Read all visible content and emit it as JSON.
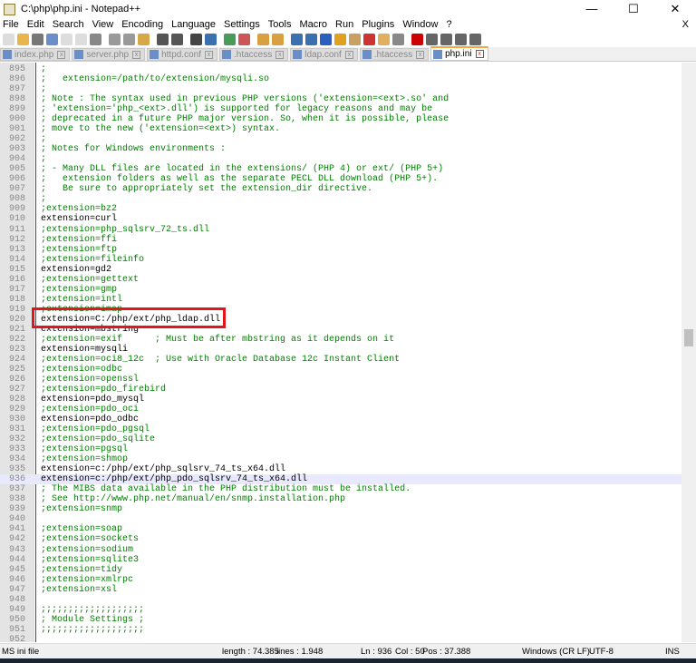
{
  "window": {
    "title": "C:\\php\\php.ini - Notepad++",
    "minimize": "—",
    "maximize": "☐",
    "close": "✕"
  },
  "menu": [
    "File",
    "Edit",
    "Search",
    "View",
    "Encoding",
    "Language",
    "Settings",
    "Tools",
    "Macro",
    "Run",
    "Plugins",
    "Window",
    "?"
  ],
  "menu_close": "X",
  "tabs": [
    {
      "label": "index.php"
    },
    {
      "label": "server.php"
    },
    {
      "label": "httpd.conf"
    },
    {
      "label": ".htaccess"
    },
    {
      "label": "ldap.conf"
    },
    {
      "label": ".htaccess"
    },
    {
      "label": "php.ini",
      "active": true
    }
  ],
  "editor": {
    "first_line": 895,
    "current_line": 936,
    "highlighted_line": 920,
    "lines": [
      ";",
      ";   extension=/path/to/extension/mysqli.so",
      ";",
      "; Note : The syntax used in previous PHP versions ('extension=<ext>.so' and",
      "; 'extension='php_<ext>.dll') is supported for legacy reasons and may be",
      "; deprecated in a future PHP major version. So, when it is possible, please",
      "; move to the new ('extension=<ext>) syntax.",
      ";",
      "; Notes for Windows environments :",
      ";",
      "; - Many DLL files are located in the extensions/ (PHP 4) or ext/ (PHP 5+)",
      ";   extension folders as well as the separate PECL DLL download (PHP 5+).",
      ";   Be sure to appropriately set the extension_dir directive.",
      ";",
      ";extension=bz2",
      "extension=curl",
      ";extension=php_sqlsrv_72_ts.dll",
      ";extension=ffi",
      ";extension=ftp",
      ";extension=fileinfo",
      "extension=gd2",
      ";extension=gettext",
      ";extension=gmp",
      ";extension=intl",
      ";extension=imap",
      "extension=C:/php/ext/php_ldap.dll",
      "extension=mbstring",
      ";extension=exif      ; Must be after mbstring as it depends on it",
      "extension=mysqli",
      ";extension=oci8_12c  ; Use with Oracle Database 12c Instant Client",
      ";extension=odbc",
      ";extension=openssl",
      ";extension=pdo_firebird",
      "extension=pdo_mysql",
      ";extension=pdo_oci",
      "extension=pdo_odbc",
      ";extension=pdo_pgsql",
      ";extension=pdo_sqlite",
      ";extension=pgsql",
      ";extension=shmop",
      "extension=c:/php/ext/php_sqlsrv_74_ts_x64.dll",
      "extension=c:/php/ext/php_pdo_sqlsrv_74_ts_x64.dll",
      "; The MIBS data available in the PHP distribution must be installed.",
      "; See http://www.php.net/manual/en/snmp.installation.php",
      ";extension=snmp",
      "",
      ";extension=soap",
      ";extension=sockets",
      ";extension=sodium",
      ";extension=sqlite3",
      ";extension=tidy",
      ";extension=xmlrpc",
      ";extension=xsl",
      "",
      ";;;;;;;;;;;;;;;;;;;",
      "; Module Settings ;",
      ";;;;;;;;;;;;;;;;;;;",
      ""
    ]
  },
  "status": {
    "filetype": "MS ini file",
    "length": "length : 74.385",
    "lines": "lines : 1.948",
    "ln": "Ln : 936",
    "col": "Col : 50",
    "pos": "Pos : 37.388",
    "eol": "Windows (CR LF)",
    "encoding": "UTF-8",
    "mode": "INS"
  },
  "colors": {
    "comment": "#008000",
    "equals": "#ff0000",
    "highlight_box": "#e3141b",
    "current_line": "#e8e8ff"
  }
}
